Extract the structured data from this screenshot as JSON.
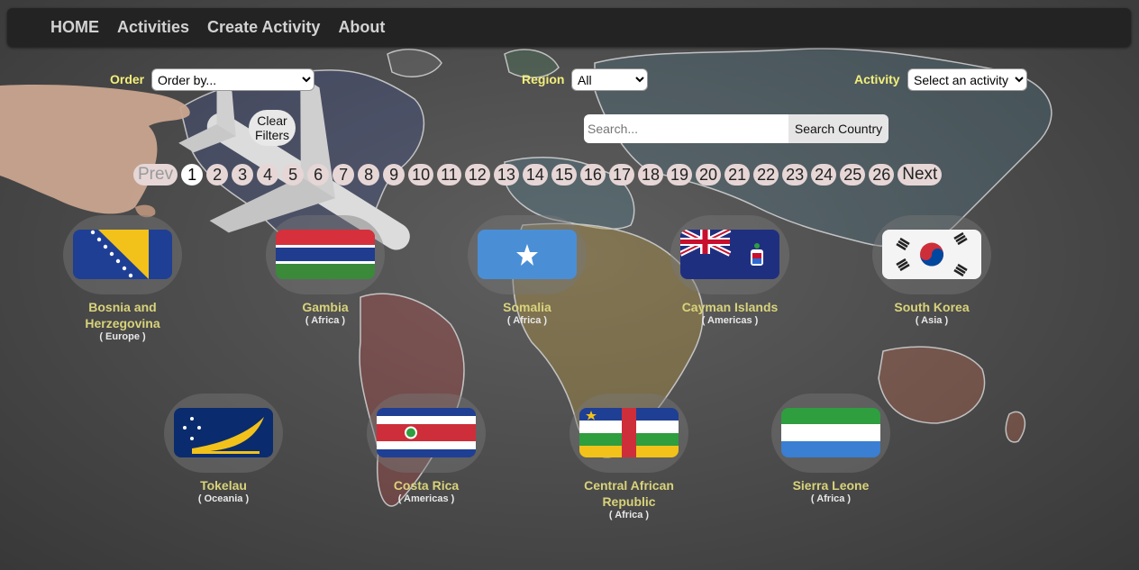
{
  "nav": {
    "items": [
      "HOME",
      "Activities",
      "Create Activity",
      "About"
    ]
  },
  "filters": {
    "order_label": "Order",
    "order_value": "Order by...",
    "region_label": "Region",
    "region_value": "All",
    "activity_label": "Activity",
    "activity_value": "Select an activity",
    "clear_line1": "Clear",
    "clear_line2": "Filters"
  },
  "search": {
    "placeholder": "Search...",
    "button_label": "Search Country"
  },
  "pagination": {
    "prev_label": "Prev",
    "next_label": "Next",
    "pages": [
      "1",
      "2",
      "3",
      "4",
      "5",
      "6",
      "7",
      "8",
      "9",
      "10",
      "11",
      "12",
      "13",
      "14",
      "15",
      "16",
      "17",
      "18",
      "19",
      "20",
      "21",
      "22",
      "23",
      "24",
      "25",
      "26"
    ],
    "current": "1"
  },
  "countries": [
    {
      "name": "Bosnia and Herzegovina",
      "name_line1": "Bosnia and",
      "name_line2": "Herzegovina",
      "region": "( Europe )",
      "flag": "bosnia-flag"
    },
    {
      "name": "Gambia",
      "region": "( Africa )",
      "flag": "gambia-flag"
    },
    {
      "name": "Somalia",
      "region": "( Africa )",
      "flag": "somalia-flag"
    },
    {
      "name": "Cayman Islands",
      "region": "( Americas )",
      "flag": "cayman-islands-flag"
    },
    {
      "name": "South Korea",
      "region": "( Asia )",
      "flag": "south-korea-flag"
    },
    {
      "name": "Tokelau",
      "region": "( Oceania )",
      "flag": "tokelau-flag"
    },
    {
      "name": "Costa Rica",
      "region": "( Americas )",
      "flag": "costa-rica-flag"
    },
    {
      "name": "Central African Republic",
      "name_line1": "Central African",
      "name_line2": "Republic",
      "region": "( Africa )",
      "flag": "central-african-republic-flag"
    },
    {
      "name": "Sierra Leone",
      "region": "( Africa )",
      "flag": "sierra-leone-flag"
    }
  ],
  "colors": {
    "label_yellow": "#f3ef7a",
    "name_yellow": "#d9d37a",
    "nav_bg": "#232323"
  }
}
